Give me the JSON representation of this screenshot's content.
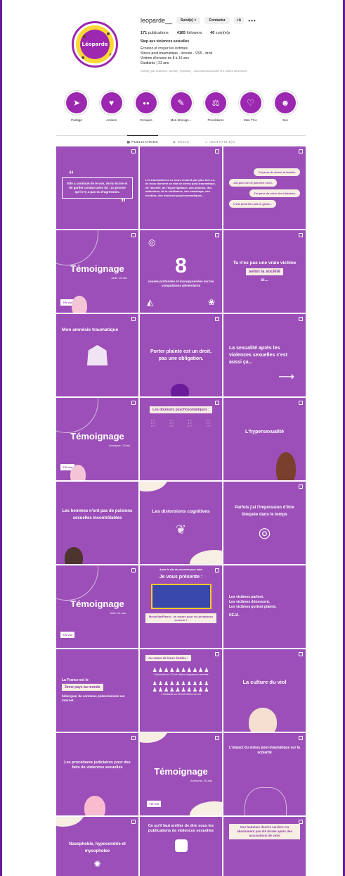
{
  "profile": {
    "username": "leoparde__",
    "follow_button": "Suivi(e) ˅",
    "contact_button": "Contacter",
    "add_button": "+A",
    "more": "•••",
    "publications_count": "171",
    "publications_label": "publications",
    "followers_count": "4185",
    "followers_label": "followers",
    "following_count": "40",
    "following_label": "suivi(e)s",
    "bio_title": "Stop aux violences sexuelles",
    "bio_line1": "Écoutez et croyez les victimes",
    "bio_line2": "Stress post-traumatique - inceste - VSS - droit",
    "bio_line3": "Victime d'inceste de 8 à 16 ans",
    "bio_line4": "Étudiante | 23 ans",
    "followed_by": "Suivi(e) par violences_women_feministe_, leconscienceso​ciale et 4 autres personnes",
    "avatar_text": "Léoparde"
  },
  "highlights": [
    {
      "label": "Partage",
      "icon": "➤"
    },
    {
      "label": "Actions",
      "icon": "♥"
    },
    {
      "label": "Groupes",
      "icon": "●●"
    },
    {
      "label": "Mon témoign...",
      "icon": "✎"
    },
    {
      "label": "Procédures",
      "icon": "⚖"
    },
    {
      "label": "Mon TCA",
      "icon": "♡"
    },
    {
      "label": "Moi",
      "icon": "☻"
    }
  ],
  "tabs": {
    "publications": "PUBLICATIONS",
    "reels": "REELS",
    "identified": "IDENTIFIÉ(E)S"
  },
  "posts": {
    "p1_quote": "Elle a continué de le voir, de lui écrire et de garder contact avec lui : ça prouve qu'il n'y a pas eu d'agression.",
    "p2_text": "Les traumatismes ne nous rendent pas plus fort.e.s, ils nous donnent un état de stress post-traumatique, de l'anxiété, de l'hypervigilance, des phobies, des addictions, de la souffrance, des handicaps, des troubles, des douleurs psychosomatiques...",
    "p3_b1": "J'ai peur de briser la famille.",
    "p3_b2": "J'ai peur de ne pas être cru.e.",
    "p3_b3": "J'ai peur de créer des histoires.",
    "p3_b4": "C'est peut-être pas si grave...",
    "p4_title": "Témoignage",
    "p4_sub": "Jade, 16 ans",
    "tw": "TW viol",
    "p5_num": "8",
    "p5_text": "causes profondes et insoupçonnées sur les compulsions alimentaires",
    "p6_line1": "Tu n'es pas une vraie victime",
    "p6_hl": "selon la société",
    "p6_line2": "si...",
    "p7_title": "Mon amnésie traumatique",
    "p8_title": "Porter plainte est un droit, pas une obligation.",
    "p9_title": "La sexualité après les violences sexuelles c'est aussi ça...",
    "p10_title": "Témoignage",
    "p10_sub": "Anonyme, 17ans",
    "p11_title": "Les douleurs psychosomatiques :",
    "p12_title": "L'hypersexualité",
    "p13_title": "Les hommes n'ont pas de pulsions sexuelles incontrôlables",
    "p14_title": "Les distorsions cognitives",
    "p15_title": "Parfois j'ai l'impression d'être bloquée dans le temps",
    "p16_title": "Témoignage",
    "p16_sub": "Maë, 21 ans",
    "p17_head": "Après le site de rencontre pour ados",
    "p17_title": "Je vous présente :",
    "p17_box": "MovieStarPlanet : un repère pour les prédateurs sexuels ?",
    "p18_line1": "Les victimes parlent.",
    "p18_line2": "Les victimes dénoncent.",
    "p18_line3": "Les victimes portent plainte.",
    "p18_line4": "DÉJÀ.",
    "p19_line1": "La France est le",
    "p19_hl": "3eme pays au monde",
    "p19_line2": "hébergeur de contenus pédocriminels sur internet.",
    "p20_head": "Au cours de leurs études :",
    "p20_s1": "1 étudiante sur 10 est victime d'agression sexuelle",
    "p20_s2": "1 étudiante sur 20 est victime de viol",
    "p21_title": "La culture du viol",
    "p22_title": "Les procédures judiciaires pour des faits de violences sexuelles",
    "p23_title": "Témoignage",
    "p23_sub": "Anonyme, 20 ans",
    "p24_title": "L'impact du stress post-traumatique sur la scolarité",
    "p25_title": "Nasophobie, hypocondrie et mysophobie",
    "p26_title": "Ce qu'il faut arrêter de dire sous les publications de violences sexuelles",
    "p27_title": "Ces hommes dont la carrière n'a absolument pas été brisée après des accusations de viols"
  }
}
